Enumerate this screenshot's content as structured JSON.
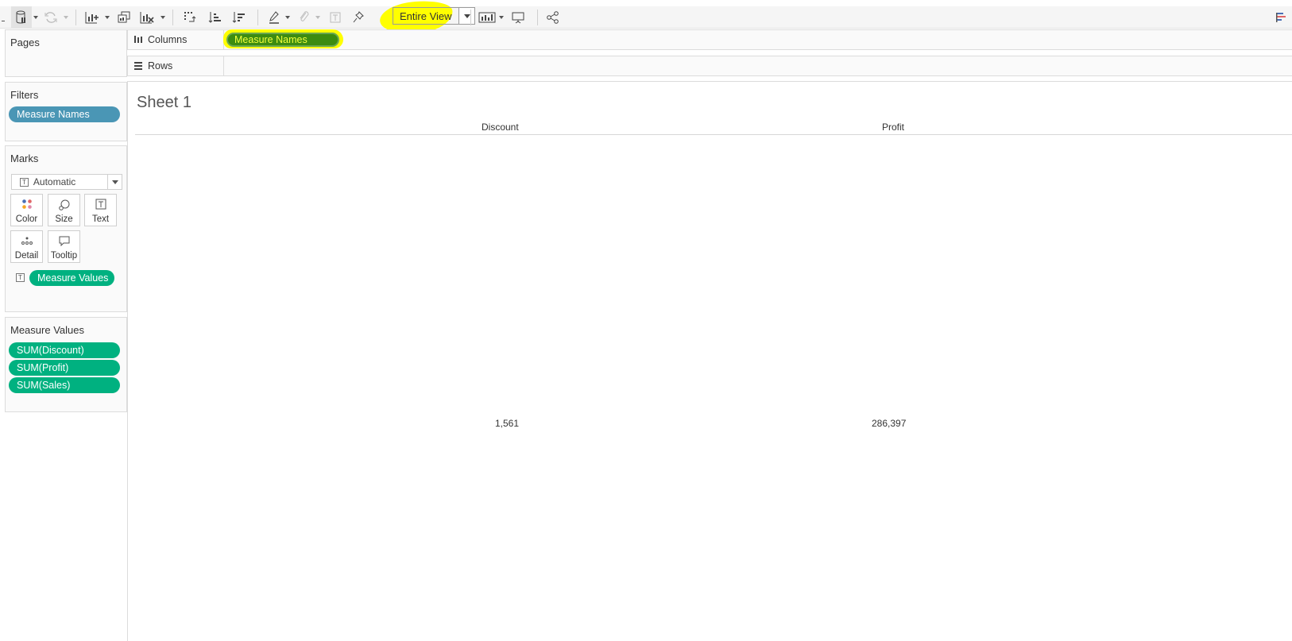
{
  "toolbar": {
    "fit_value": "Entire View",
    "icons": [
      "data-source-icon",
      "refresh-icon",
      "new-worksheet-icon",
      "duplicate-sheet-icon",
      "clear-sheet-icon",
      "swap-icon",
      "sort-ascending-icon",
      "sort-descending-icon",
      "highlight-icon",
      "group-icon",
      "label-icon",
      "pin-icon",
      "show-me-icon",
      "presentation-icon",
      "share-icon",
      "show-me-panel-icon"
    ],
    "highlight_color": "#ffff00"
  },
  "panels": {
    "pages": {
      "title": "Pages"
    },
    "filters": {
      "title": "Filters",
      "pills": [
        "Measure Names"
      ]
    },
    "marks": {
      "title": "Marks",
      "mark_type": "Automatic",
      "buttons": [
        "Color",
        "Size",
        "Text",
        "Detail",
        "Tooltip"
      ],
      "field_pill": "Measure Values"
    },
    "measure_values": {
      "title": "Measure Values",
      "pills": [
        "SUM(Discount)",
        "SUM(Profit)",
        "SUM(Sales)"
      ]
    }
  },
  "shelves": {
    "columns": {
      "label": "Columns",
      "pill": "Measure Names"
    },
    "rows": {
      "label": "Rows"
    }
  },
  "sheet": {
    "title": "Sheet 1",
    "columns": [
      {
        "header": "Discount",
        "value": "1,561"
      },
      {
        "header": "Profit",
        "value": "286,397"
      }
    ]
  },
  "colors": {
    "dimension_pill": "#4a96b5",
    "measure_pill": "#00b180",
    "columns_pill": "#3c8c10"
  }
}
